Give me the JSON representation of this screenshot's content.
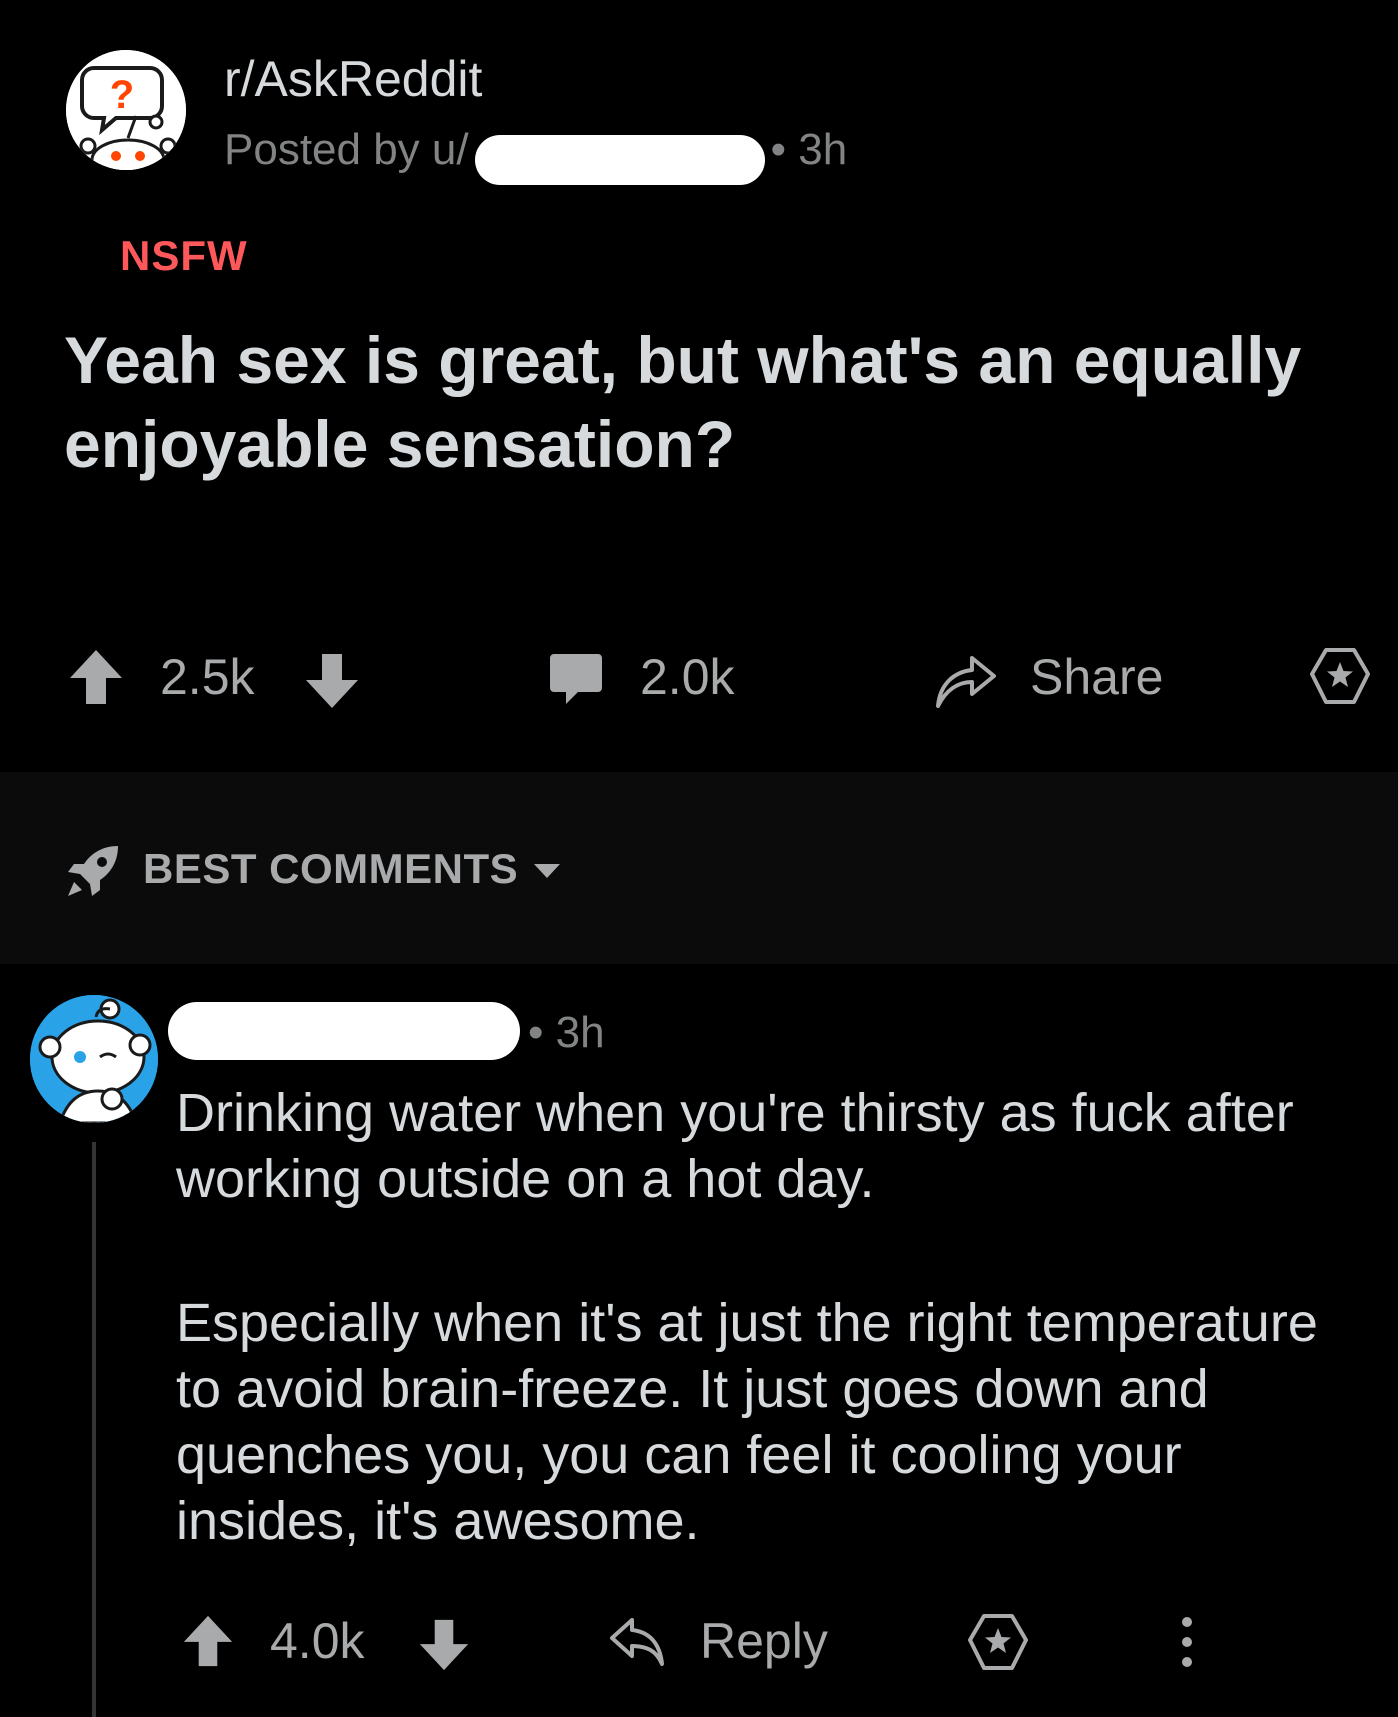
{
  "post": {
    "subreddit": "r/AskReddit",
    "posted_by_prefix": "Posted by u/",
    "age": "• 3h",
    "nsfw_label": "NSFW",
    "title": "Yeah sex is great, but what's an equally enjoyable sensation?",
    "score": "2.5k",
    "comments": "2.0k",
    "share_label": "Share"
  },
  "sort": {
    "label": "BEST COMMENTS"
  },
  "comment": {
    "age": "• 3h",
    "paragraph1": "Drinking water when you're thirsty as fuck after working outside on a hot day.",
    "paragraph2": "Especially when it's at just the right temperature to avoid brain-freeze. It just goes down and quenches you, you can feel it cooling your insides, it's awesome.",
    "score": "4.0k",
    "reply_label": "Reply"
  },
  "colors": {
    "background": "#000000",
    "nsfw": "#ff585b",
    "avatar_blue": "#2aa2e8",
    "muted_text": "#818384"
  },
  "icons": [
    "askreddit-avatar",
    "upvote-icon",
    "downvote-icon",
    "comment-icon",
    "share-icon",
    "award-icon",
    "rocket-icon",
    "chevron-down-icon",
    "reply-icon",
    "more-icon",
    "snoo-avatar"
  ]
}
